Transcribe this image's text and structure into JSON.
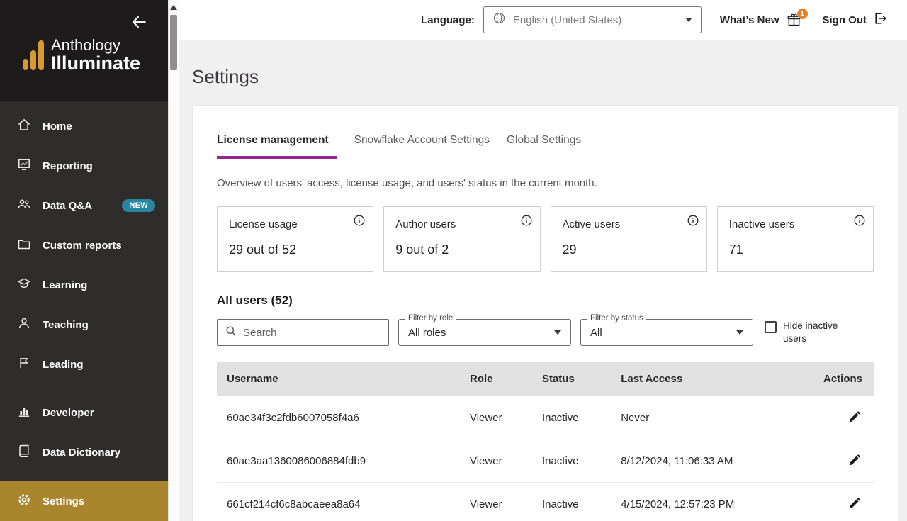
{
  "colors": {
    "accent-purple": "#93278f",
    "sidebar-gold": "#a9852e",
    "logo-gold": "#d89a2f",
    "badge-teal": "#2787a0",
    "badge-orange": "#e8821e"
  },
  "sidebar": {
    "logo_line1": "Anthology",
    "logo_line2": "Illuminate",
    "items": [
      {
        "label": "Home"
      },
      {
        "label": "Reporting"
      },
      {
        "label": "Data Q&A",
        "badge": "NEW"
      },
      {
        "label": "Custom reports"
      },
      {
        "label": "Learning"
      },
      {
        "label": "Teaching"
      },
      {
        "label": "Leading"
      },
      {
        "label": "Developer"
      },
      {
        "label": "Data Dictionary"
      },
      {
        "label": "Settings"
      }
    ]
  },
  "topbar": {
    "language_label": "Language:",
    "language_value": "English (United States)",
    "whats_new": "What’s New",
    "whats_new_badge": "1",
    "sign_out": "Sign Out"
  },
  "page": {
    "title": "Settings",
    "tabs": [
      {
        "label": "License management"
      },
      {
        "label": "Snowflake Account Settings"
      },
      {
        "label": "Global Settings"
      }
    ],
    "overview_text": "Overview of users' access, license usage, and users' status in the current month.",
    "stats": [
      {
        "label": "License usage",
        "value": "29 out of 52"
      },
      {
        "label": "Author users",
        "value": "9 out of 2"
      },
      {
        "label": "Active users",
        "value": "29"
      },
      {
        "label": "Inactive users",
        "value": "71"
      }
    ],
    "all_users_heading": "All users (52)",
    "search_placeholder": "Search",
    "filter_role_label": "Filter by role",
    "filter_role_value": "All roles",
    "filter_status_label": "Filter by status",
    "filter_status_value": "All",
    "hide_inactive_label": "Hide inactive users",
    "table": {
      "headers": [
        "Username",
        "Role",
        "Status",
        "Last Access",
        "Actions"
      ],
      "rows": [
        {
          "username": "60ae34f3c2fdb6007058f4a6",
          "role": "Viewer",
          "status": "Inactive",
          "last_access": "Never"
        },
        {
          "username": "60ae3aa1360086006884fdb9",
          "role": "Viewer",
          "status": "Inactive",
          "last_access": "8/12/2024, 11:06:33 AM"
        },
        {
          "username": "661cf214cf6c8abcaeea8a64",
          "role": "Viewer",
          "status": "Inactive",
          "last_access": "4/15/2024, 12:57:23 PM"
        }
      ]
    }
  }
}
